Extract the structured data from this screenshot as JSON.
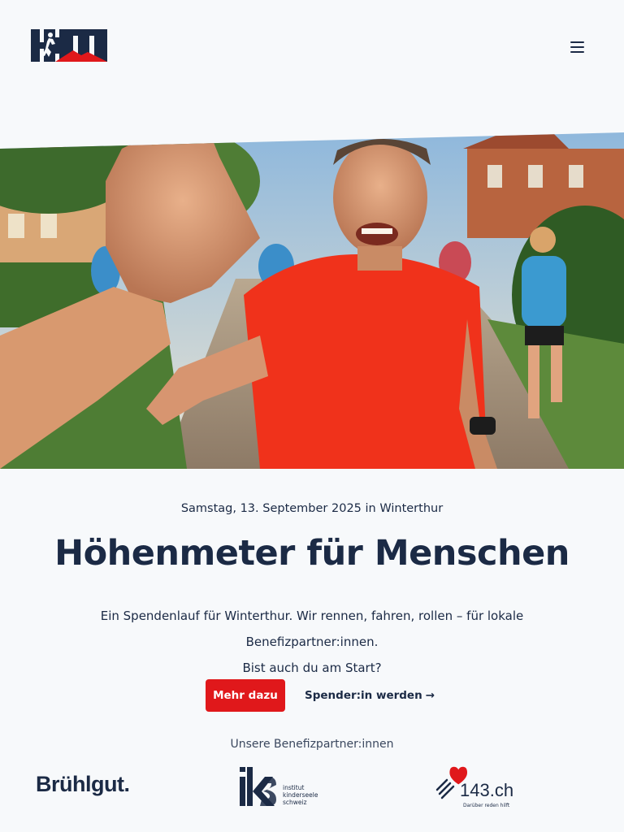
{
  "header": {
    "logo_text": "HFM",
    "menu_icon": "hamburger-menu-icon"
  },
  "hero": {
    "image_alt": "Lachender Läufer im roten Shirt gibt ein High Five"
  },
  "event": {
    "date_line": "Samstag, 13. September 2025 in Winterthur",
    "title": "Höhenmeter für Menschen",
    "lead_line1": "Ein Spendenlauf für Winterthur. Wir rennen, fahren, rollen – für lokale Benefizpartner:innen.",
    "lead_line2": "Bist auch du am Start?"
  },
  "actions": {
    "primary_label": "Mehr dazu",
    "secondary_label": "Spender:in werden",
    "secondary_arrow": "→"
  },
  "partners": {
    "title": "Unsere Benefizpartner:innen",
    "items": [
      {
        "name": "Brühlgut."
      },
      {
        "name": "iks",
        "line1": "institut",
        "line2": "kinderseele",
        "line3": "schweiz"
      },
      {
        "name": "143.ch",
        "tagline": "Darüber reden hilft"
      }
    ]
  },
  "colors": {
    "primary_red": "#e0181b",
    "navy": "#1b2a45",
    "background": "#f7f9fb"
  }
}
